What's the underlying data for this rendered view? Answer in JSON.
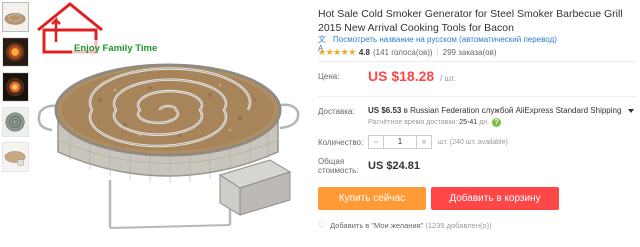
{
  "product": {
    "title": "Hot Sale Cold Smoker Generator for Steel Smoker Barbecue Grill 2015 New Arrival Cooking Tools for Bacon",
    "watermark": "Enjoy Family Time",
    "translate_link": "Посмотреть название на русском (автоматический перевод)",
    "translate_icon": "translate-icon",
    "rating": {
      "stars_text": "★★★★★",
      "score": "4.8",
      "votes": "(141 голоса(ов))",
      "orders": "299 заказа(ов)"
    }
  },
  "price": {
    "label": "Цена:",
    "value": "US $18.28",
    "unit": "/ шт."
  },
  "shipping": {
    "label": "Доставка:",
    "cost": "US $6.53",
    "destination": "в Russian Federation службой AliExpress Standard Shipping",
    "estimate_label": "Расчётное время доставки:",
    "estimate_days": "25-41",
    "estimate_unit": "дн.",
    "help_text": "?"
  },
  "quantity": {
    "label": "Количество:",
    "minus": "−",
    "value": "1",
    "plus": "+",
    "available": "шт. (240 шт. available)"
  },
  "total": {
    "label_line1": "Общая",
    "label_line2": "стоимость:",
    "value": "US $24.81"
  },
  "actions": {
    "buy_now": "Купить сейчас",
    "add_to_cart": "Добавить в корзину"
  },
  "wishlist": {
    "label": "Добавить в \"Мои желания\"",
    "count": "(1235 добавлен(о))"
  },
  "colors": {
    "price_red": "#ff4747",
    "buy_orange": "#ff9a35",
    "cart_red": "#ff4747",
    "link_blue": "#2f7fc8",
    "star": "#f5a623",
    "watermark_red": "#e02020",
    "watermark_green": "#1a9a2a"
  }
}
